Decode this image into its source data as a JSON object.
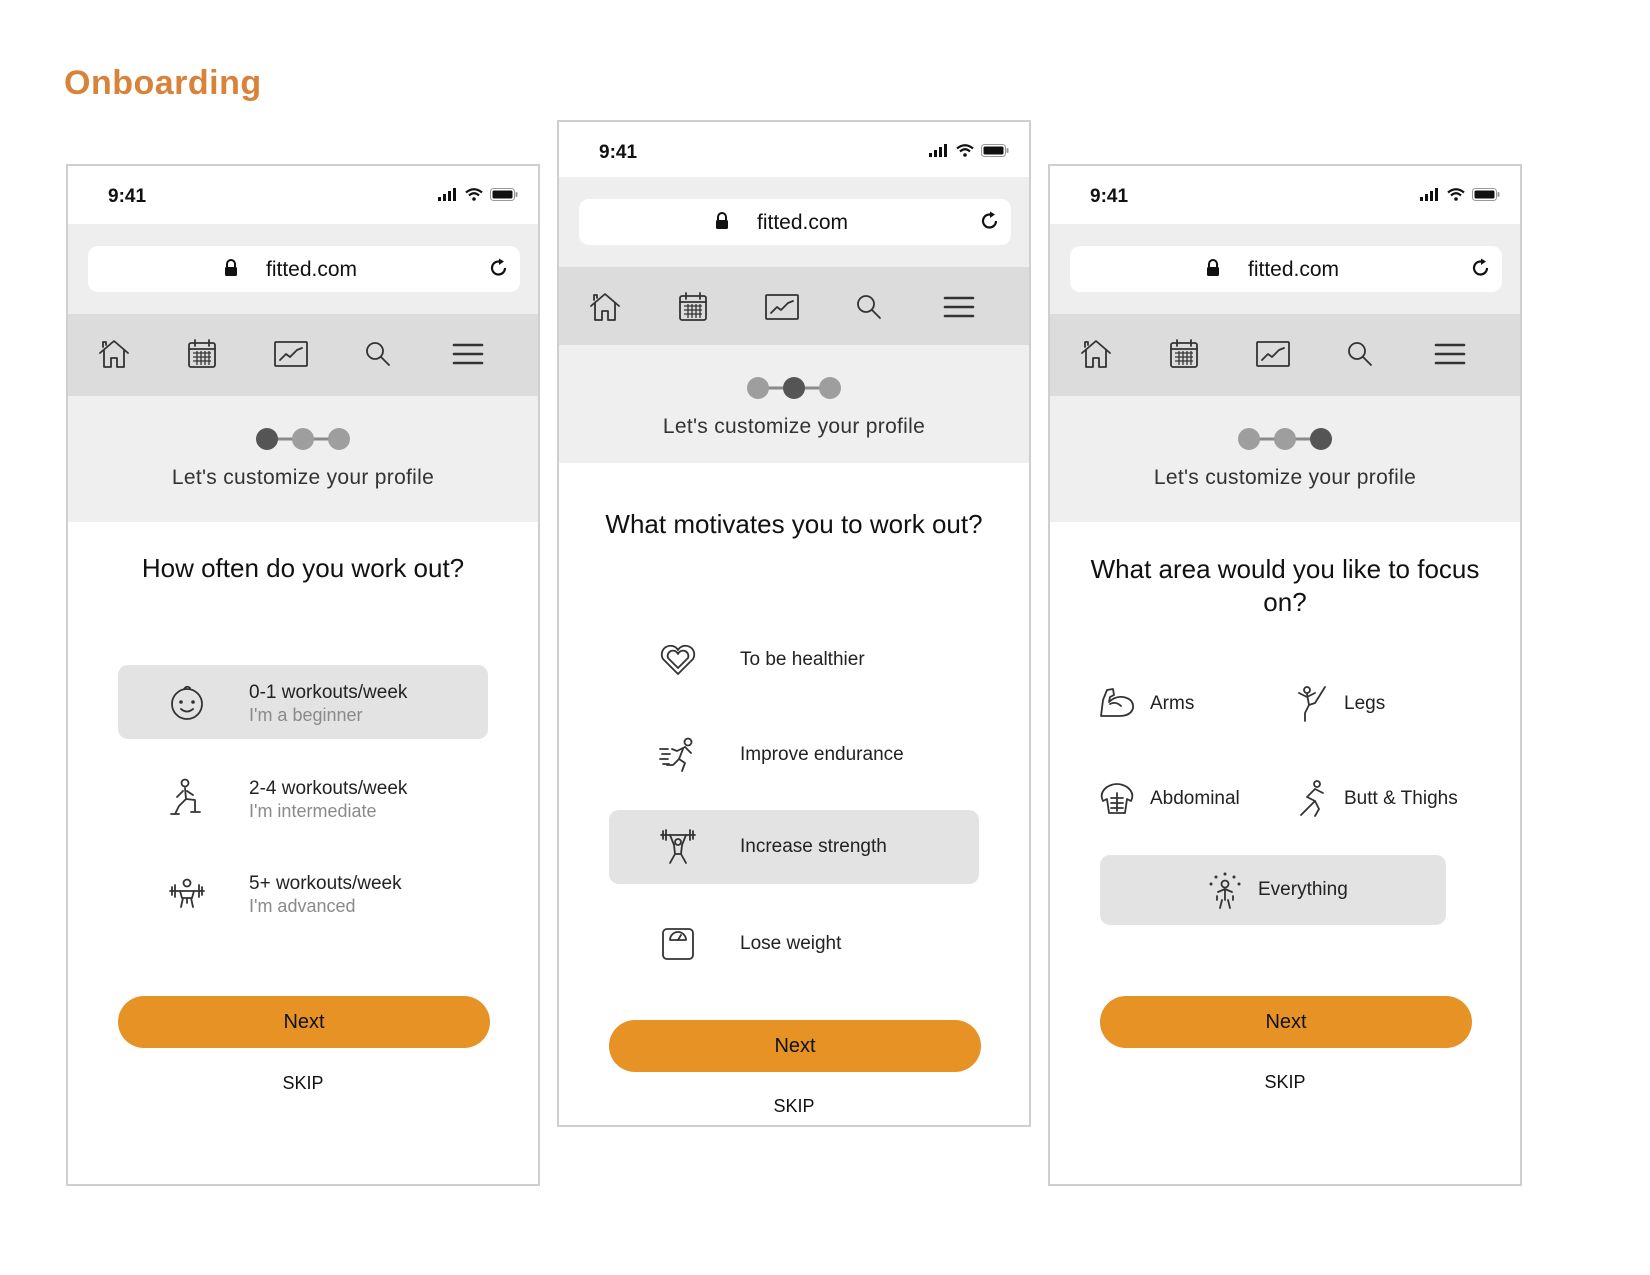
{
  "page": {
    "title": "Onboarding"
  },
  "colors": {
    "accent": "#e69225",
    "title": "#d9823a",
    "selected": "#e3e3e3",
    "header_bg": "#efefef",
    "nav_bg": "#dcdcdc"
  },
  "screens": [
    {
      "status": {
        "time": "9:41"
      },
      "browser": {
        "url": "fitted.com"
      },
      "nav": {
        "icons": [
          "home-icon",
          "calendar-icon",
          "chart-icon",
          "search-icon",
          "menu-icon"
        ]
      },
      "header": {
        "text": "Let's customize your profile",
        "step": 1,
        "total_steps": 3
      },
      "question": "How often do you work out?",
      "options": [
        {
          "title": "0-1 workouts/week",
          "subtitle": "I'm a beginner",
          "icon": "baby-face-icon",
          "selected": true
        },
        {
          "title": "2-4 workouts/week",
          "subtitle": "I'm intermediate",
          "icon": "lunge-icon",
          "selected": false
        },
        {
          "title": "5+ workouts/week",
          "subtitle": "I'm advanced",
          "icon": "weightlifter-icon",
          "selected": false
        }
      ],
      "next_label": "Next",
      "skip_label": "SKIP"
    },
    {
      "status": {
        "time": "9:41"
      },
      "browser": {
        "url": "fitted.com"
      },
      "nav": {
        "icons": [
          "home-icon",
          "calendar-icon",
          "chart-icon",
          "search-icon",
          "menu-icon"
        ]
      },
      "header": {
        "text": "Let's customize your profile",
        "step": 2,
        "total_steps": 3
      },
      "question": "What motivates you to work out?",
      "options": [
        {
          "title": "To be healthier",
          "icon": "heart-icon",
          "selected": false
        },
        {
          "title": "Improve endurance",
          "icon": "runner-icon",
          "selected": false
        },
        {
          "title": "Increase strength",
          "icon": "barbell-icon",
          "selected": true
        },
        {
          "title": "Lose weight",
          "icon": "scale-icon",
          "selected": false
        }
      ],
      "next_label": "Next",
      "skip_label": "SKIP"
    },
    {
      "status": {
        "time": "9:41"
      },
      "browser": {
        "url": "fitted.com"
      },
      "nav": {
        "icons": [
          "home-icon",
          "calendar-icon",
          "chart-icon",
          "search-icon",
          "menu-icon"
        ]
      },
      "header": {
        "text": "Let's customize your profile",
        "step": 3,
        "total_steps": 3
      },
      "question": "What area would you like to focus on?",
      "areas": [
        {
          "label": "Arms",
          "icon": "arm-icon",
          "selected": false
        },
        {
          "label": "Legs",
          "icon": "leg-kick-icon",
          "selected": false
        },
        {
          "label": "Abdominal",
          "icon": "abs-icon",
          "selected": false
        },
        {
          "label": "Butt & Thighs",
          "icon": "squat-icon",
          "selected": false
        },
        {
          "label": "Everything",
          "icon": "full-body-icon",
          "selected": true
        }
      ],
      "next_label": "Next",
      "skip_label": "SKIP"
    }
  ]
}
